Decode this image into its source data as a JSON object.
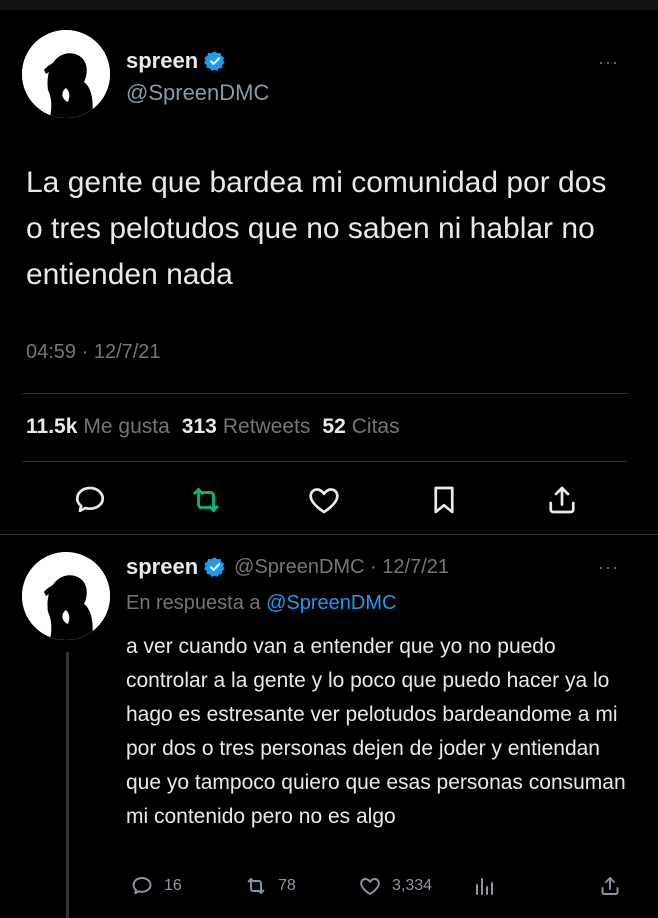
{
  "main_tweet": {
    "author_name": "spreen",
    "handle": "@SpreenDMC",
    "more": "···",
    "text": "La gente que bardea mi comunidad por dos o tres pelotudos que no saben ni hablar no entienden nada",
    "timestamp": "04:59 · 12/7/21",
    "stats": {
      "likes_count": "11.5k",
      "likes_label": "Me gusta",
      "retweets_count": "313",
      "retweets_label": "Retweets",
      "quotes_count": "52",
      "quotes_label": "Citas"
    }
  },
  "reply": {
    "author_name": "spreen",
    "meta": "@SpreenDMC · 12/7/21",
    "more": "···",
    "replying_prefix": "En respuesta a",
    "replying_handle": "@SpreenDMC",
    "text": "a ver cuando van a entender que yo no puedo controlar a la gente y lo poco que puedo hacer ya lo hago es estresante ver pelotudos bardeandome a mi por dos o tres personas dejen de joder y entiendan que yo tampoco quiero que esas personas consuman mi contenido pero no es algo",
    "reply_count": "16",
    "retweet_count": "78",
    "like_count": "3,334"
  },
  "colors": {
    "accent": "#1d9bf0",
    "retweet_green": "#00ba7c",
    "muted": "#71767b",
    "background": "#000000"
  }
}
